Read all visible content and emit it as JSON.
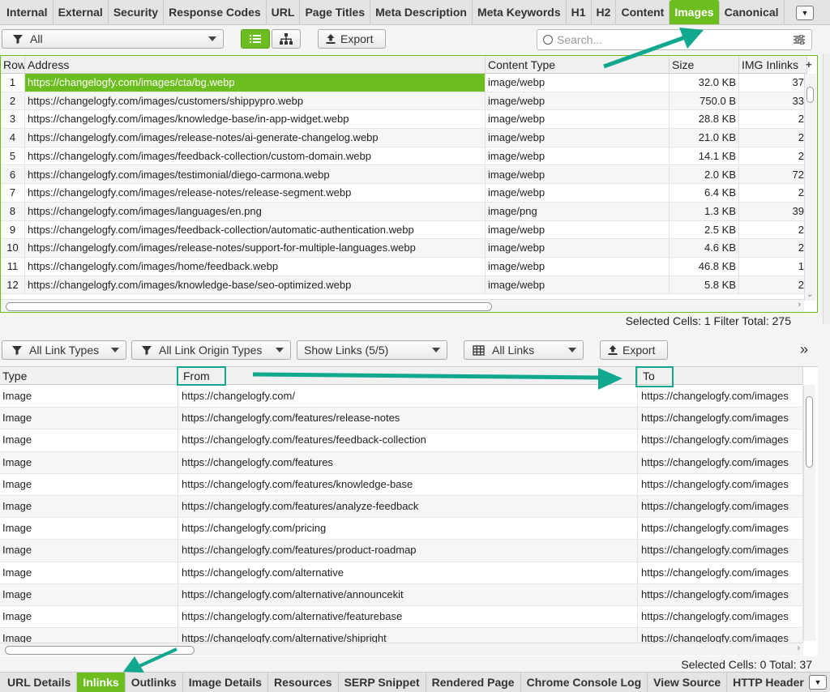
{
  "top_tabs": [
    "Internal",
    "External",
    "Security",
    "Response Codes",
    "URL",
    "Page Titles",
    "Meta Description",
    "Meta Keywords",
    "H1",
    "H2",
    "Content",
    "Images",
    "Canonical"
  ],
  "active_top_tab": "Images",
  "toolbar": {
    "filter": "All",
    "export": "Export",
    "search_placeholder": "Search..."
  },
  "images_table": {
    "headers": [
      "Row",
      "Address",
      "Content Type",
      "Size",
      "IMG Inlinks"
    ],
    "rows": [
      [
        "1",
        "https://changelogfy.com/images/cta/bg.webp",
        "image/webp",
        "32.0 KB",
        "37"
      ],
      [
        "2",
        "https://changelogfy.com/images/customers/shippypro.webp",
        "image/webp",
        "750.0 B",
        "33"
      ],
      [
        "3",
        "https://changelogfy.com/images/knowledge-base/in-app-widget.webp",
        "image/webp",
        "28.8 KB",
        "2"
      ],
      [
        "4",
        "https://changelogfy.com/images/release-notes/ai-generate-changelog.webp",
        "image/webp",
        "21.0 KB",
        "2"
      ],
      [
        "5",
        "https://changelogfy.com/images/feedback-collection/custom-domain.webp",
        "image/webp",
        "14.1 KB",
        "2"
      ],
      [
        "6",
        "https://changelogfy.com/images/testimonial/diego-carmona.webp",
        "image/webp",
        "2.0 KB",
        "72"
      ],
      [
        "7",
        "https://changelogfy.com/images/release-notes/release-segment.webp",
        "image/webp",
        "6.4 KB",
        "2"
      ],
      [
        "8",
        "https://changelogfy.com/images/languages/en.png",
        "image/png",
        "1.3 KB",
        "39"
      ],
      [
        "9",
        "https://changelogfy.com/images/feedback-collection/automatic-authentication.webp",
        "image/webp",
        "2.5 KB",
        "2"
      ],
      [
        "10",
        "https://changelogfy.com/images/release-notes/support-for-multiple-languages.webp",
        "image/webp",
        "4.6 KB",
        "2"
      ],
      [
        "11",
        "https://changelogfy.com/images/home/feedback.webp",
        "image/webp",
        "46.8 KB",
        "1"
      ],
      [
        "12",
        "https://changelogfy.com/images/knowledge-base/seo-optimized.webp",
        "image/webp",
        "5.8 KB",
        "2"
      ]
    ],
    "status": "Selected Cells:  1  Filter Total:  275"
  },
  "lower_toolbar": {
    "link_types": "All Link Types",
    "origin_types": "All Link Origin Types",
    "show_links": "Show Links (5/5)",
    "all_links": "All Links",
    "export": "Export",
    "more": "»"
  },
  "inlinks_table": {
    "headers": [
      "Type",
      "From",
      "To"
    ],
    "rows": [
      [
        "Image",
        "https://changelogfy.com/",
        "https://changelogfy.com/images"
      ],
      [
        "Image",
        "https://changelogfy.com/features/release-notes",
        "https://changelogfy.com/images"
      ],
      [
        "Image",
        "https://changelogfy.com/features/feedback-collection",
        "https://changelogfy.com/images"
      ],
      [
        "Image",
        "https://changelogfy.com/features",
        "https://changelogfy.com/images"
      ],
      [
        "Image",
        "https://changelogfy.com/features/knowledge-base",
        "https://changelogfy.com/images"
      ],
      [
        "Image",
        "https://changelogfy.com/features/analyze-feedback",
        "https://changelogfy.com/images"
      ],
      [
        "Image",
        "https://changelogfy.com/pricing",
        "https://changelogfy.com/images"
      ],
      [
        "Image",
        "https://changelogfy.com/features/product-roadmap",
        "https://changelogfy.com/images"
      ],
      [
        "Image",
        "https://changelogfy.com/alternative",
        "https://changelogfy.com/images"
      ],
      [
        "Image",
        "https://changelogfy.com/alternative/announcekit",
        "https://changelogfy.com/images"
      ],
      [
        "Image",
        "https://changelogfy.com/alternative/featurebase",
        "https://changelogfy.com/images"
      ],
      [
        "Image",
        "https://changelogfy.com/alternative/shipright",
        "https://changelogfy.com/images"
      ]
    ],
    "status": "Selected Cells:  0  Total:  37"
  },
  "bottom_tabs": [
    "URL Details",
    "Inlinks",
    "Outlinks",
    "Image Details",
    "Resources",
    "SERP Snippet",
    "Rendered Page",
    "Chrome Console Log",
    "View Source",
    "HTTP Header"
  ],
  "active_bottom_tab": "Inlinks",
  "colors": {
    "accent": "#6cbd1f",
    "annotation": "#11a88f"
  }
}
